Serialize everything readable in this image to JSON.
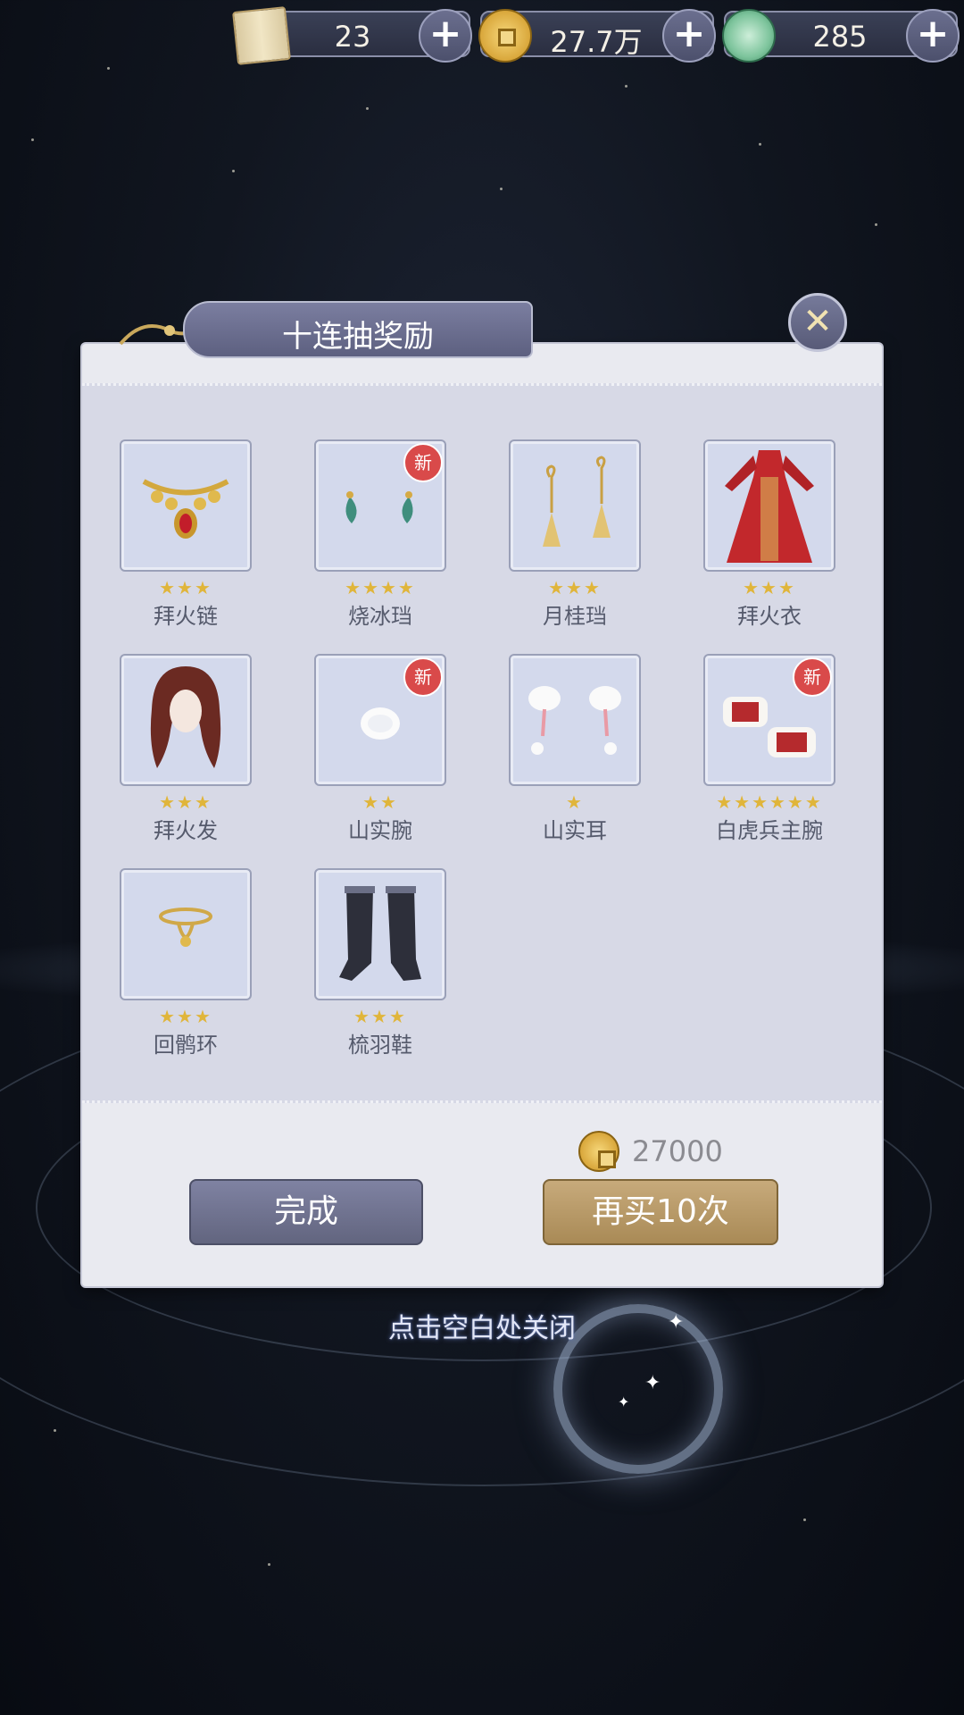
{
  "currencies": [
    {
      "icon": "scroll-icon",
      "value": "23"
    },
    {
      "icon": "coin-icon",
      "value": "27.7万"
    },
    {
      "icon": "jade-icon",
      "value": "285"
    }
  ],
  "dialog": {
    "title": "十连抽奖励",
    "items": [
      {
        "name": "拜火链",
        "stars": "★★★",
        "stars_count": 3,
        "is_new": false,
        "icon": "necklace-icon"
      },
      {
        "name": "烧冰珰",
        "stars": "★★★★",
        "stars_count": 4,
        "is_new": true,
        "icon": "earring-icon"
      },
      {
        "name": "月桂珰",
        "stars": "★★★",
        "stars_count": 3,
        "is_new": false,
        "icon": "earring-icon"
      },
      {
        "name": "拜火衣",
        "stars": "★★★",
        "stars_count": 3,
        "is_new": false,
        "icon": "dress-icon"
      },
      {
        "name": "拜火发",
        "stars": "★★★",
        "stars_count": 3,
        "is_new": false,
        "icon": "hair-icon"
      },
      {
        "name": "山实腕",
        "stars": "★★",
        "stars_count": 2,
        "is_new": true,
        "icon": "cuff-icon"
      },
      {
        "name": "山实耳",
        "stars": "★",
        "stars_count": 1,
        "is_new": false,
        "icon": "ear-muff-icon"
      },
      {
        "name": "白虎兵主腕",
        "stars": "★★★★★★",
        "stars_count": 6,
        "is_new": true,
        "icon": "cuff-icon"
      },
      {
        "name": "回鹘环",
        "stars": "★★★",
        "stars_count": 3,
        "is_new": false,
        "icon": "anklet-icon"
      },
      {
        "name": "梳羽鞋",
        "stars": "★★★",
        "stars_count": 3,
        "is_new": false,
        "icon": "boots-icon"
      }
    ],
    "new_badge": "新",
    "cost_amount": "27000",
    "done_label": "完成",
    "buy_again_label": "再买10次"
  },
  "hint": "点击空白处关闭"
}
